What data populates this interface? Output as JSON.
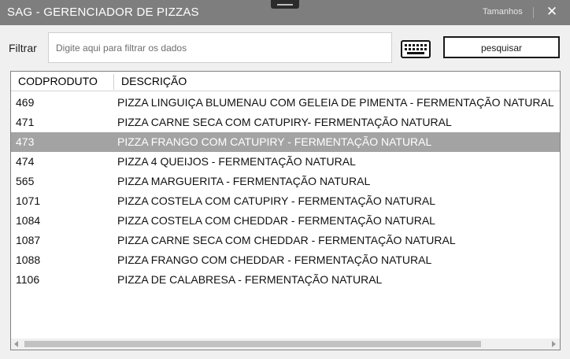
{
  "window": {
    "title": "SAG - GERENCIADOR DE PIZZAS",
    "sizes_label": "Tamanhos",
    "close_glyph": "✕"
  },
  "filter": {
    "label": "Filtrar",
    "placeholder": "Digite aqui para filtrar os dados",
    "value": "",
    "search_label": "pesquisar"
  },
  "grid": {
    "columns": [
      "CODPRODUTO",
      "DESCRIÇÃO"
    ],
    "selected_index": 2,
    "rows": [
      {
        "code": "469",
        "desc": "PIZZA LINGUIÇA BLUMENAU COM GELEIA DE PIMENTA - FERMENTAÇÃO NATURAL"
      },
      {
        "code": "471",
        "desc": "PIZZA CARNE SECA COM CATUPIRY- FERMENTAÇÃO NATURAL"
      },
      {
        "code": "473",
        "desc": "PIZZA FRANGO COM CATUPIRY - FERMENTAÇÃO NATURAL"
      },
      {
        "code": "474",
        "desc": "PIZZA 4 QUEIJOS - FERMENTAÇÃO NATURAL"
      },
      {
        "code": "565",
        "desc": "PIZZA MARGUERITA - FERMENTAÇÃO NATURAL"
      },
      {
        "code": "1071",
        "desc": "PIZZA COSTELA COM CATUPIRY - FERMENTAÇÃO NATURAL"
      },
      {
        "code": "1084",
        "desc": "PIZZA COSTELA COM CHEDDAR - FERMENTAÇÃO NATURAL"
      },
      {
        "code": "1087",
        "desc": "PIZZA CARNE SECA COM CHEDDAR - FERMENTAÇÃO NATURAL"
      },
      {
        "code": "1088",
        "desc": "PIZZA FRANGO COM CHEDDAR - FERMENTAÇÃO NATURAL"
      },
      {
        "code": "1106",
        "desc": "PIZZA DE CALABRESA - FERMENTAÇÃO NATURAL"
      }
    ]
  },
  "icons": {
    "keyboard": "keyboard-icon",
    "close": "close-icon",
    "scroll_left": "scroll-left-icon",
    "scroll_right": "scroll-right-icon"
  },
  "colors": {
    "titlebar": "#7e7e7e",
    "selected_row": "#a3a3a3"
  }
}
